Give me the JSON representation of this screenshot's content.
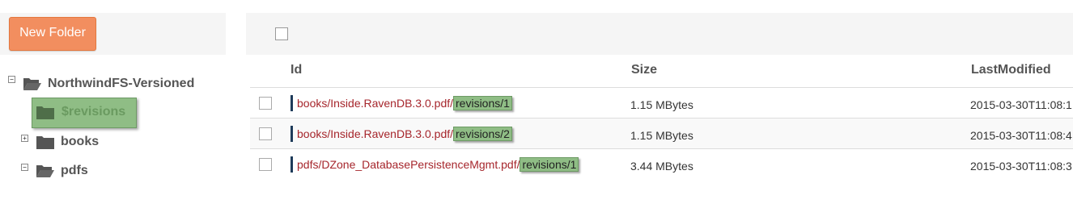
{
  "toolbar": {
    "new_folder_label": "New Folder"
  },
  "tree": {
    "root": {
      "label": "NorthwindFS-Versioned",
      "toggle": "−"
    },
    "items": [
      {
        "label": "$revisions",
        "selected": true
      },
      {
        "label": "books",
        "toggle": "+"
      },
      {
        "label": "pdfs",
        "toggle": "−"
      }
    ]
  },
  "table": {
    "headers": {
      "id": "Id",
      "size": "Size",
      "last_modified": "LastModified"
    },
    "rows": [
      {
        "path": "books/Inside.RavenDB.3.0.pdf/",
        "revision": "revisions/1",
        "size": "1.15 MBytes",
        "last_modified": "2015-03-30T11:08:1"
      },
      {
        "path": "books/Inside.RavenDB.3.0.pdf/",
        "revision": "revisions/2",
        "size": "1.15 MBytes",
        "last_modified": "2015-03-30T11:08:4"
      },
      {
        "path": "pdfs/DZone_DatabasePersistenceMgmt.pdf/",
        "revision": "revisions/1",
        "size": "3.44 MBytes",
        "last_modified": "2015-03-30T11:08:3"
      }
    ]
  },
  "colors": {
    "accent_button": "#f28e5f",
    "selection_green": "#8fbd85",
    "link_red": "#a6262c",
    "row_marker": "#1e3b5a"
  }
}
